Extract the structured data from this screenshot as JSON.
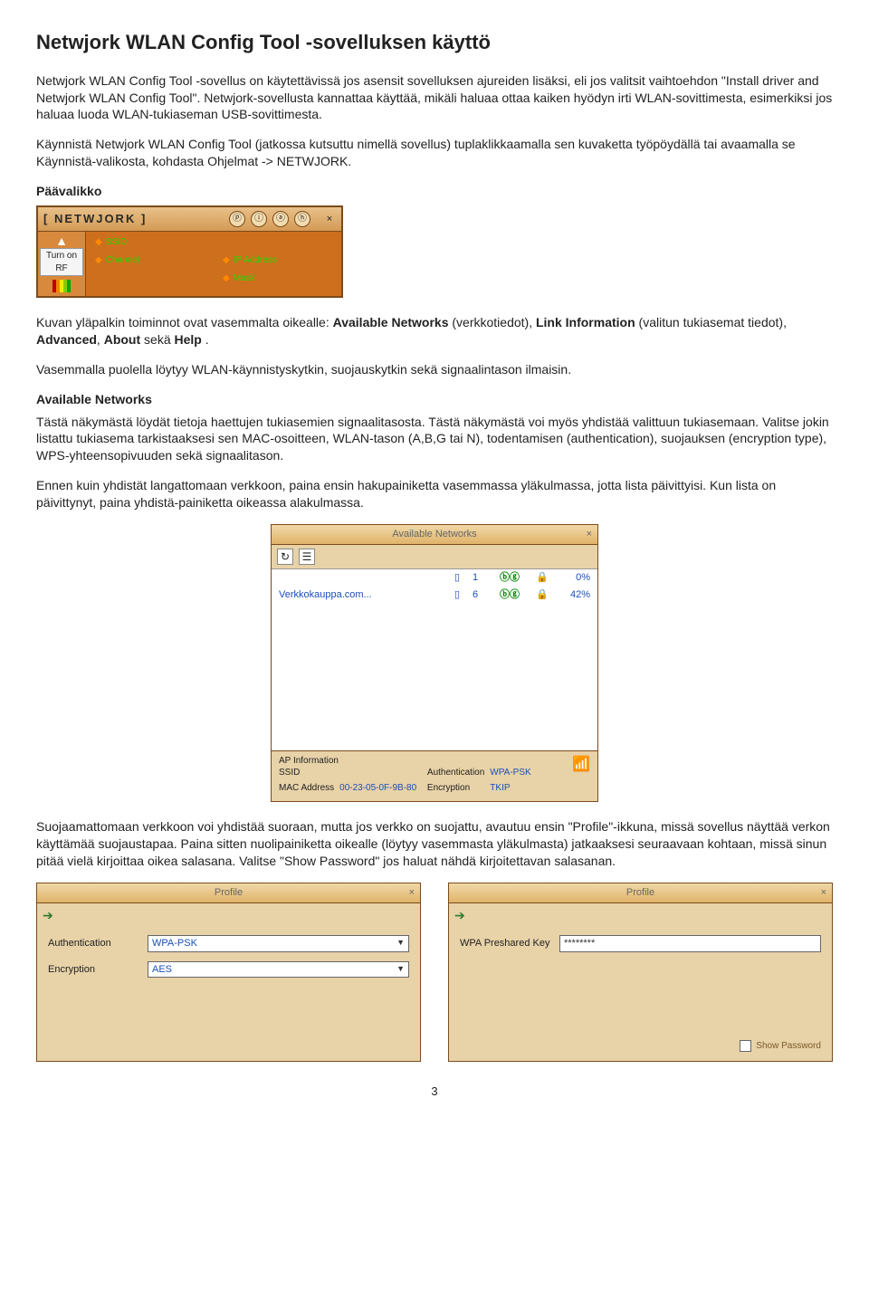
{
  "title": "Netwjork WLAN Config Tool -sovelluksen käyttö",
  "intro_p1": "Netwjork WLAN Config Tool -sovellus on käytettävissä jos asensit sovelluksen ajureiden lisäksi, eli jos valitsit vaihtoehdon \"Install driver and Netwjork WLAN Config Tool\". Netwjork-sovellusta kannattaa käyttää, mikäli haluaa ottaa kaiken hyödyn irti WLAN-sovittimesta, esimerkiksi jos haluaa luoda WLAN-tukiaseman USB-sovittimesta.",
  "intro_p2": "Käynnistä Netwjork WLAN Config Tool (jatkossa kutsuttu nimellä sovellus) tuplaklikkaamalla sen kuvaketta työpöydällä tai avaamalla se Käynnistä-valikosta, kohdasta Ohjelmat -> NETWJORK.",
  "main_menu_label": "Päävalikko",
  "widget_main": {
    "title": "[ NETWJORK ]",
    "icons": [
      "ⓟ",
      "ⓘ",
      "ⓐ",
      "ⓗ"
    ],
    "close": "×",
    "turn_on": "Turn on RF",
    "fields": {
      "ssid": "SSID",
      "ip": "IP Address",
      "channel": "Channel",
      "mask": "Mask"
    }
  },
  "main_desc_p1a": "Kuvan yläpalkin toiminnot ovat vasemmalta oikealle: ",
  "main_desc_p1b": " (verkkotiedot), ",
  "main_desc_p1c": " (valitun tukiasemat tiedot), ",
  "main_desc_p1d": " sekä ",
  "main_desc_p1e": ".",
  "bold": {
    "available_networks": "Available Networks",
    "link_information": "Link Information",
    "advanced": "Advanced",
    "about": "About",
    "help": "Help"
  },
  "main_desc_p2": "Vasemmalla puolella löytyy WLAN-käynnistyskytkin, suojauskytkin sekä signaalintason ilmaisin.",
  "av_heading": "Available Networks",
  "av_p1": "Tästä näkymästä löydät tietoja haettujen tukiasemien signaalitasosta. Tästä näkymästä voi myös yhdistää valittuun tukiasemaan. Valitse jokin listattu tukiasema tarkistaaksesi sen MAC-osoitteen, WLAN-tason (A,B,G tai N), todentamisen (authentication), suojauksen (encryption type), WPS-yhteensopivuuden sekä signaalitason.",
  "av_p2": "Ennen kuin yhdistät langattomaan verkkoon, paina ensin hakupainiketta vasemmassa yläkulmassa, jotta lista päivittyisi. Kun lista on päivittynyt, paina yhdistä-painiketta oikeassa alakulmassa.",
  "av_window": {
    "title": "Available Networks",
    "close": "×",
    "rows": [
      {
        "name": "",
        "chan": "1",
        "pct": "0%"
      },
      {
        "name": "Verkkokauppa.com...",
        "chan": "6",
        "pct": "42%"
      }
    ],
    "info_label": "AP Information",
    "ssid_label": "SSID",
    "ssid_val": "",
    "mac_label": "MAC Address",
    "mac_val": "00-23-05-0F-9B-80",
    "auth_label": "Authentication",
    "auth_val": "WPA-PSK",
    "enc_label": "Encryption",
    "enc_val": "TKIP"
  },
  "profile_intro": "Suojaamattomaan verkkoon voi yhdistää suoraan, mutta jos verkko on suojattu, avautuu ensin \"Profile\"-ikkuna, missä sovellus näyttää verkon käyttämää suojaustapaa. Paina sitten nuolipainiketta oikealle (löytyy vasemmasta yläkulmasta) jatkaaksesi seuraavaan kohtaan, missä sinun pitää vielä kirjoittaa oikea salasana. Valitse \"Show Password\" jos haluat nähdä kirjoitettavan salasanan.",
  "profile1": {
    "title": "Profile",
    "close": "×",
    "auth_label": "Authentication",
    "auth_val": "WPA-PSK",
    "enc_label": "Encryption",
    "enc_val": "AES"
  },
  "profile2": {
    "title": "Profile",
    "close": "×",
    "key_label": "WPA Preshared Key",
    "key_val": "********",
    "show_pw": "Show Password"
  },
  "page_number": "3"
}
